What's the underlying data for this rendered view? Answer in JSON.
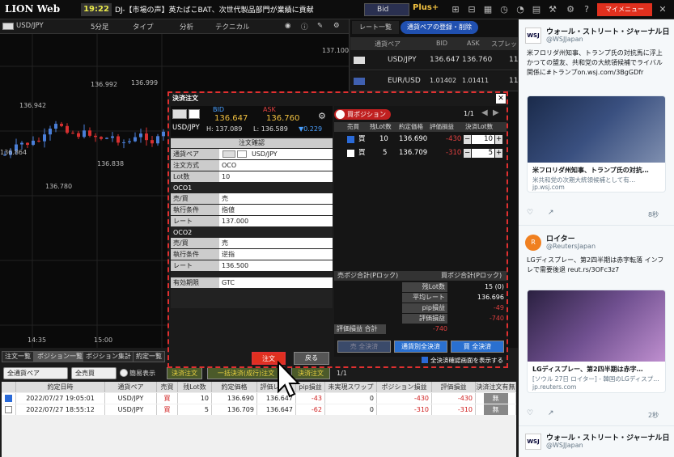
{
  "topbar": {
    "logo": "LION Web",
    "time": "19:22",
    "news": "DJ-【市場の声】英たばこBAT、次世代製品部門が業績に貢献",
    "bid_select": "Bid",
    "plus": "Plus+",
    "my_menu": "マイメニュー"
  },
  "chart": {
    "pair": "USD/JPY",
    "interval": "5分足",
    "type": "タイプ",
    "analysis": "分析",
    "technical": "テクニカル",
    "price_right": "137.100",
    "labels": {
      "l1": "136.942",
      "l2": "136.992",
      "l3": "136.999",
      "l4": "136.864",
      "l5": "136.838",
      "l6": "136.780"
    },
    "times": {
      "t1": "14:35",
      "t2": "15:00"
    }
  },
  "rates": {
    "tab1": "レート一覧",
    "tab2": "通貨ペアの登録・削除",
    "col_pair": "通貨ペア",
    "col_bid": "BID",
    "col_ask": "ASK",
    "col_spread": "スプレッ",
    "rows": [
      {
        "pair": "USD/JPY",
        "bid": "136.647",
        "ask": "136.760",
        "spread": "11"
      },
      {
        "pair": "EUR/USD",
        "bid": "1.01402",
        "ask": "1.01411",
        "spread": "11"
      }
    ]
  },
  "dialog": {
    "title": "決済注文",
    "bid_label": "BID",
    "ask_label": "ASK",
    "pair": "USD/JPY",
    "bid": "136.647",
    "ask": "136.760",
    "high": "H: 137.089",
    "low": "L: 136.589",
    "change": "▼0.229",
    "confirm_title": "注文確認",
    "fields": {
      "pair_k": "通貨ペア",
      "pair_v": "USD/JPY",
      "method_k": "注文方式",
      "method_v": "OCO",
      "lot_k": "Lot数",
      "lot_v": "10"
    },
    "oco1": {
      "title": "OCO1",
      "side_k": "売/買",
      "side_v": "売",
      "cond_k": "執行条件",
      "cond_v": "指値",
      "rate_k": "レート",
      "rate_v": "137.000"
    },
    "oco2": {
      "title": "OCO2",
      "side_k": "売/買",
      "side_v": "売",
      "cond_k": "執行条件",
      "cond_v": "逆指",
      "rate_k": "レート",
      "rate_v": "136.500"
    },
    "expiry_k": "有効期限",
    "expiry_v": "GTC",
    "buy_position": "買ポジション",
    "page": "1/1",
    "pos_cols": {
      "c1": "売買",
      "c2": "残Lot数",
      "c3": "約定価格",
      "c4": "評価損益",
      "c5": "決済Lot数"
    },
    "positions": [
      {
        "side": "買",
        "lot": "10",
        "price": "136.690",
        "pl": "-430",
        "qty": "10"
      },
      {
        "side": "買",
        "lot": "5",
        "price": "136.709",
        "pl": "-310",
        "qty": "5"
      }
    ],
    "sum": {
      "sell_head": "売ポジ合計(Pロック)",
      "buy_head": "買ポジ合計(Pロック)",
      "lot_k": "残Lot数",
      "lot_v": "15 (0)",
      "avg_k": "平均レート",
      "avg_v": "136.696",
      "pip_k": "pip損益",
      "pip_v": "-49",
      "eval_k": "評価損益",
      "eval_v": "-740",
      "total_k": "評価損益 合計",
      "total_v": "-740"
    },
    "btn_sell_all": "売 全決済",
    "btn_pair_all": "通貨別全決済",
    "btn_buy_all": "買 全決済",
    "show_confirm": "全決済確認画面を表示する",
    "btn_order": "注文",
    "btn_back": "戻る"
  },
  "bottom": {
    "tabs": [
      "注文一覧",
      "ポジション一覧",
      "ポジション集計",
      "約定一覧"
    ],
    "sel_pair": "全通貨ペア",
    "sel_side": "全売買",
    "simple": "簡易表示",
    "settle": "決済注文",
    "bulk": "一括決済(成行)注文",
    "bulk2": "決済注文",
    "page": "1/1",
    "cols": [
      "約定日時",
      "通貨ペア",
      "売買",
      "残Lot数",
      "約定価格",
      "評価レート",
      "pip損益",
      "未実現スワップ",
      "ポジション損益",
      "評価損益",
      "決済注文有無"
    ],
    "rows": [
      {
        "date": "2022/07/27 19:05:01",
        "pair": "USD/JPY",
        "side": "買",
        "lot": "10",
        "price": "136.690",
        "rate": "136.647",
        "pip": "-43",
        "swap": "0",
        "pos_pl": "-430",
        "eval": "-430",
        "status": "無"
      },
      {
        "date": "2022/07/27 18:55:12",
        "pair": "USD/JPY",
        "side": "買",
        "lot": "5",
        "price": "136.709",
        "rate": "136.647",
        "pip": "-62",
        "swap": "0",
        "pos_pl": "-310",
        "eval": "-310",
        "status": "無"
      }
    ]
  },
  "twitter": {
    "t1_name": "ウォール・ストリート・ジャーナル日",
    "t1_handle": "@WSJJapan",
    "t1_text": "米フロリダ州知事、トランプ氏の対抗馬に浮上 かつての盟友、共和党の大統領候補でライバル関係に#トランプon.wsj.com/3BgGDfr",
    "c1_title": "米フロリダ州知事、トランプ氏の対抗…",
    "c1_desc": "米共和党の次期大統領候補として有…",
    "c1_domain": "jp.wsj.com",
    "t1_time": "8秒",
    "t2_name": "ロイター",
    "t2_handle": "@ReutersJapan",
    "t2_text": "LGディスプレー、第2四半期は赤字転落 インフレで需要後退 reut.rs/3OFc3z7",
    "c2_title": "LGディスプレー、第2四半期は赤字…",
    "c2_desc": "[ソウル 27日 ロイター] - 韓国のLGディスプ…",
    "c2_domain": "jp.reuters.com",
    "t2_time": "2秒",
    "t3_name": "ウォール・ストリート・ジャーナル日",
    "t3_handle": "@WSJJapan"
  },
  "colors": {
    "bull": "#4a7fd8",
    "bear": "#d83030",
    "accent": "#e0301e"
  }
}
